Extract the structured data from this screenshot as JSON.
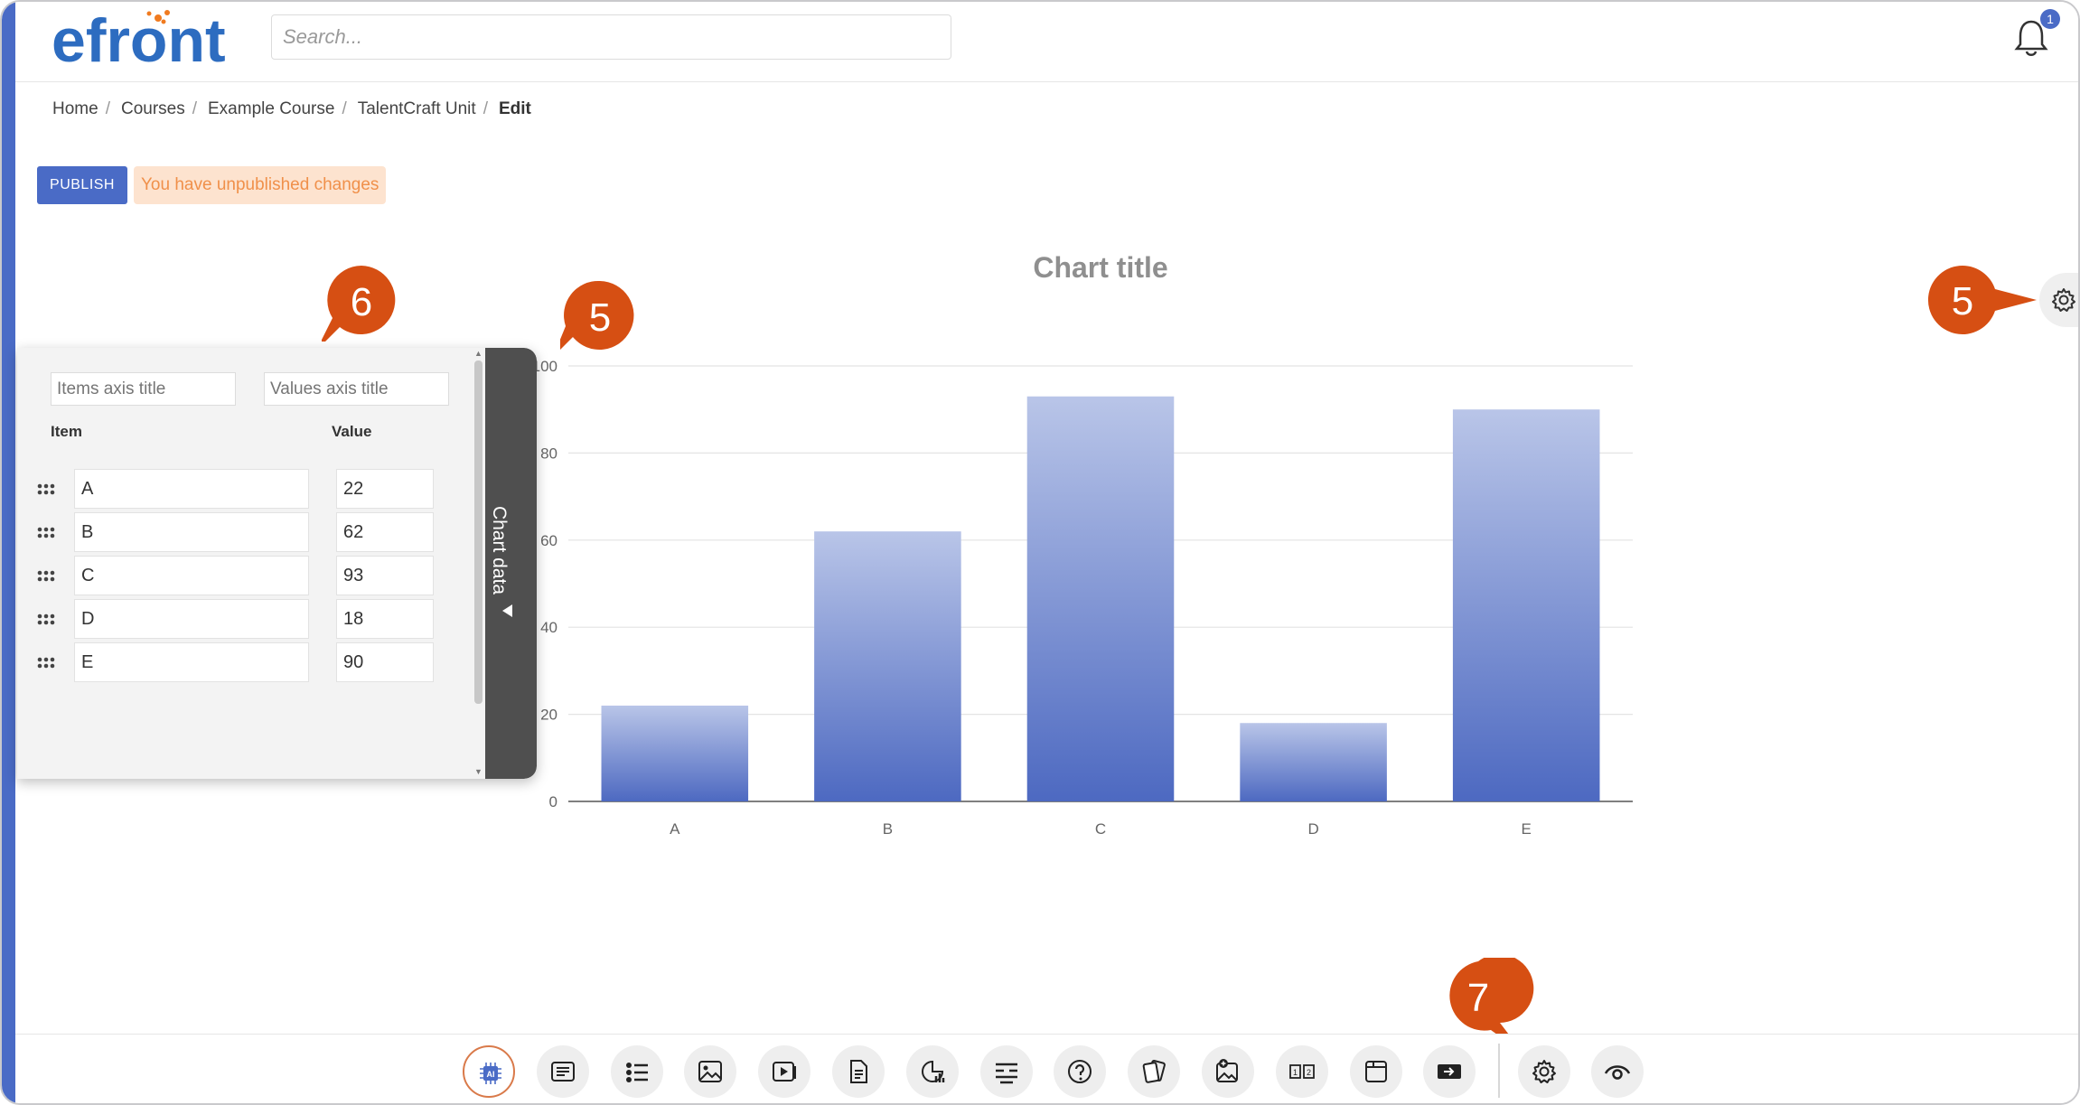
{
  "app": {
    "logo_text": "efront",
    "search_placeholder": "Search...",
    "notification_count": "1"
  },
  "breadcrumb": [
    {
      "label": "Home"
    },
    {
      "label": "Courses"
    },
    {
      "label": "Example Course"
    },
    {
      "label": "TalentCraft Unit"
    }
  ],
  "breadcrumb_current": "Edit",
  "breadcrumb_separator": "/",
  "toolbar": {
    "publish_label": "PUBLISH",
    "unpublished_notice": "You have unpublished changes"
  },
  "panel": {
    "items_axis_placeholder": "Items axis title",
    "values_axis_placeholder": "Values axis title",
    "col_item": "Item",
    "col_value": "Value",
    "tab_label": "Chart data",
    "rows": [
      {
        "item": "A",
        "value": "22"
      },
      {
        "item": "B",
        "value": "62"
      },
      {
        "item": "C",
        "value": "93"
      },
      {
        "item": "D",
        "value": "18"
      },
      {
        "item": "E",
        "value": "90"
      }
    ]
  },
  "markers": [
    {
      "label": "6"
    },
    {
      "label": "5"
    },
    {
      "label": "5"
    },
    {
      "label": "7"
    }
  ],
  "colors": {
    "accent": "#4a6bc6",
    "marker": "#d64f13",
    "notice_bg": "#fde3cf",
    "notice_text": "#f0904a",
    "bar_top": "#b9c5e8",
    "bar_bottom": "#4d69c1"
  },
  "bottom_tools": [
    {
      "icon": "ai-chip-icon"
    },
    {
      "icon": "text-block-icon"
    },
    {
      "icon": "list-icon"
    },
    {
      "icon": "image-icon"
    },
    {
      "icon": "video-icon"
    },
    {
      "icon": "document-icon"
    },
    {
      "icon": "chart-icon"
    },
    {
      "icon": "fill-blanks-icon"
    },
    {
      "icon": "question-icon"
    },
    {
      "icon": "flashcards-icon"
    },
    {
      "icon": "image-hotspot-icon"
    },
    {
      "icon": "ordering-icon"
    },
    {
      "icon": "embed-window-icon"
    },
    {
      "icon": "next-slide-icon"
    },
    {
      "icon": "settings-icon"
    },
    {
      "icon": "preview-icon"
    }
  ],
  "chart_data": {
    "type": "bar",
    "title": "Chart title",
    "categories": [
      "A",
      "B",
      "C",
      "D",
      "E"
    ],
    "values": [
      22,
      62,
      93,
      18,
      90
    ],
    "ylim": [
      0,
      100
    ],
    "yticks": [
      "0",
      "20",
      "40",
      "60",
      "80",
      "100"
    ],
    "grid": true,
    "xlabel": "",
    "ylabel": ""
  }
}
